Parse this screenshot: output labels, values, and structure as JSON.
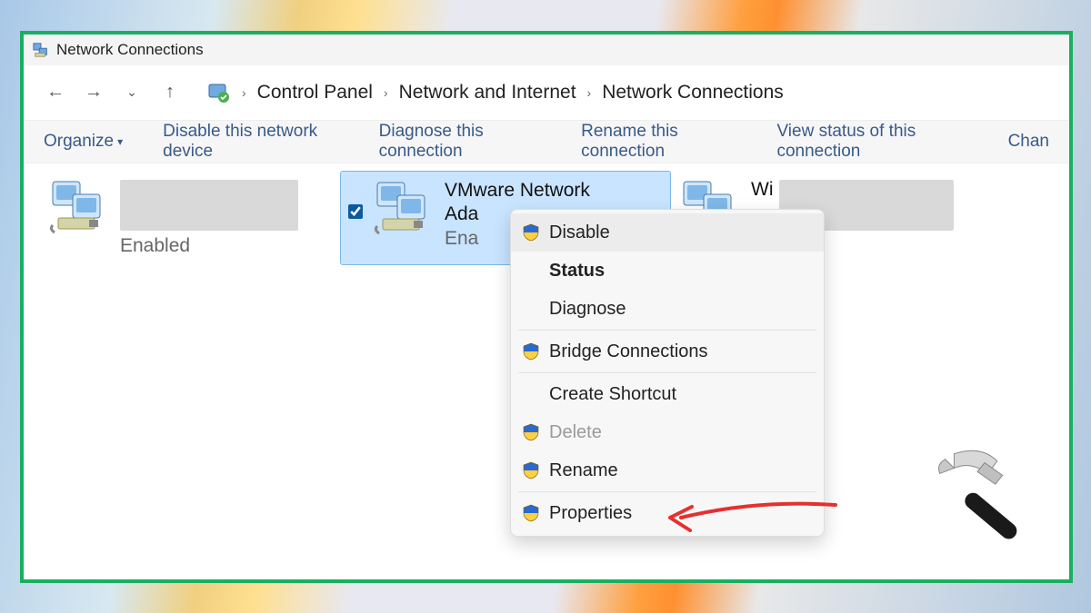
{
  "window": {
    "title": "Network Connections"
  },
  "breadcrumbs": {
    "item0": "Control Panel",
    "item1": "Network and Internet",
    "item2": "Network Connections"
  },
  "commands": {
    "organize": "Organize",
    "disable_device": "Disable this network device",
    "diagnose": "Diagnose this connection",
    "rename": "Rename this connection",
    "view_status": "View status of this connection",
    "change": "Chan"
  },
  "adapters": {
    "a0": {
      "status": "Enabled"
    },
    "a1": {
      "name_line1": "VMware Network",
      "name_line2": "Ada",
      "status": "Ena"
    },
    "a2": {
      "name_prefix": "Wi"
    }
  },
  "context_menu": {
    "disable": "Disable",
    "status": "Status",
    "diagnose": "Diagnose",
    "bridge": "Bridge Connections",
    "shortcut": "Create Shortcut",
    "delete": "Delete",
    "rename": "Rename",
    "properties": "Properties"
  }
}
